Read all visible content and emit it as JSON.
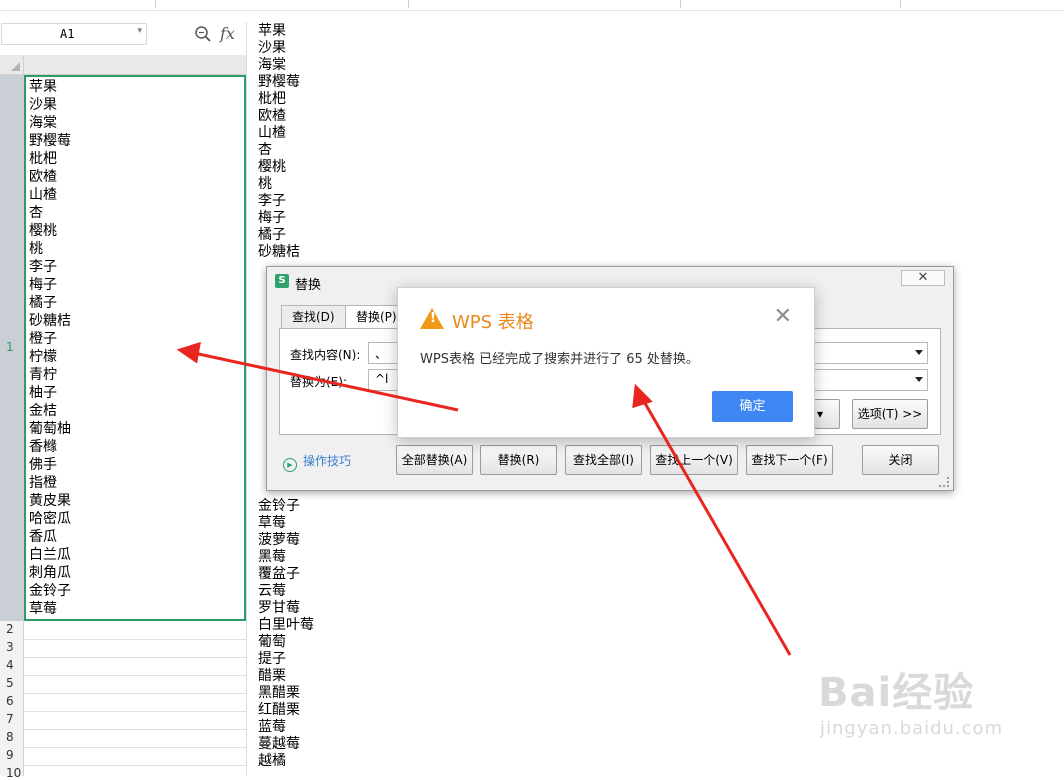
{
  "namebox": {
    "ref": "A1"
  },
  "formula": {
    "fx_label": "fx"
  },
  "row_numbers": [
    "1",
    "2",
    "3",
    "4",
    "5",
    "6",
    "7",
    "8",
    "9",
    "10"
  ],
  "cell_a1_lines": [
    "苹果",
    "沙果",
    "海棠",
    "野樱莓",
    "枇杷",
    "欧楂",
    "山楂",
    "杏",
    "樱桃",
    "桃",
    "李子",
    "梅子",
    "橘子",
    "砂糖桔",
    "橙子",
    "柠檬",
    "青柠",
    "柚子",
    "金桔",
    "葡萄柚",
    "香橼",
    "佛手",
    "指橙",
    "黄皮果",
    "哈密瓜",
    "香瓜",
    "白兰瓜",
    "刺角瓜",
    "金铃子",
    "草莓"
  ],
  "right_top_lines": [
    "苹果",
    "沙果",
    "海棠",
    "野樱莓",
    "枇杷",
    "欧楂",
    "山楂",
    "杏",
    "樱桃",
    "桃",
    "李子",
    "梅子",
    "橘子",
    "砂糖桔"
  ],
  "right_bottom_lines": [
    "金铃子",
    "草莓",
    "菠萝莓",
    "黑莓",
    "覆盆子",
    "云莓",
    "罗甘莓",
    "白里叶莓",
    "葡萄",
    "提子",
    "醋栗",
    "黑醋栗",
    "红醋栗",
    "蓝莓",
    "蔓越莓",
    "越橘"
  ],
  "replace_dialog": {
    "title": "替换",
    "tabs": [
      "查找(D)",
      "替换(P)"
    ],
    "find_label": "查找内容(N):",
    "find_value": "、",
    "replace_label": "替换为(E):",
    "replace_value": "^l",
    "options_button": "选项(T) >>",
    "tips_label": "操作技巧",
    "buttons": [
      "全部替换(A)",
      "替换(R)",
      "查找全部(I)",
      "查找上一个(V)",
      "查找下一个(F)"
    ],
    "close_button": "关闭"
  },
  "message_box": {
    "title": "WPS 表格",
    "text": "WPS表格 已经完成了搜索并进行了 65 处替换。",
    "ok_button": "确定"
  },
  "watermark": {
    "brand": "Bai经验",
    "url": "jingyan.baidu.com"
  },
  "colors": {
    "selection_border": "#2e9b6a",
    "primary_button": "#3e86f1",
    "warning": "#f19a19",
    "annotation_arrow": "#e8261f"
  }
}
